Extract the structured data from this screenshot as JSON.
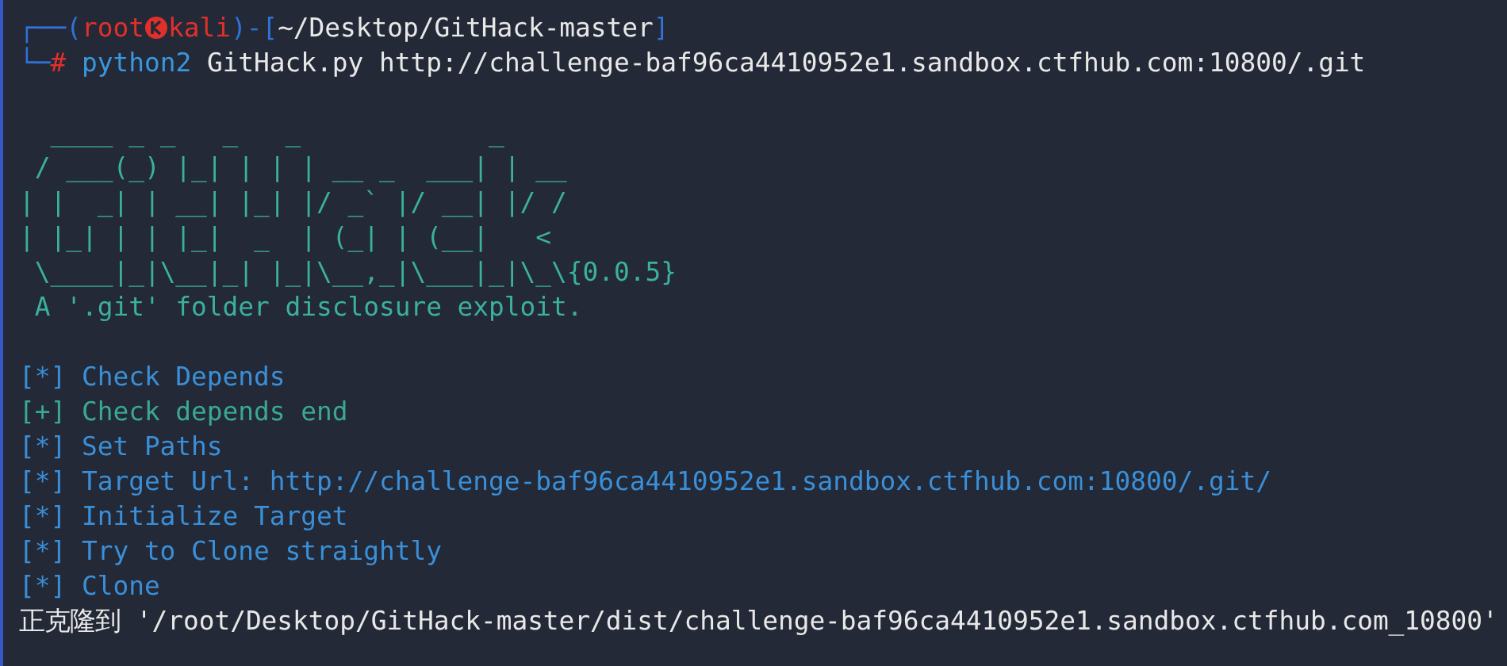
{
  "terminal": {
    "blocks": [
      {
        "lines": [
          {
            "segments": [
              {
                "kind": "frame",
                "text": "┌──("
              },
              {
                "kind": "user",
                "text": "root"
              },
              {
                "kind": "icon"
              },
              {
                "kind": "user",
                "text": "kali"
              },
              {
                "kind": "frame",
                "text": ")-["
              },
              {
                "kind": "path",
                "text": "~/Desktop/GitHack-master"
              },
              {
                "kind": "frame",
                "text": "]"
              }
            ]
          },
          {
            "segments": [
              {
                "kind": "frame",
                "text": "└─"
              },
              {
                "kind": "hash",
                "text": "#"
              },
              {
                "kind": "program",
                "text": " python2"
              },
              {
                "kind": "plain",
                "text": " GitHack.py http://challenge-baf96ca4410952e1.sandbox.ctfhub.com:10800/.git"
              }
            ]
          }
        ]
      },
      {
        "lines": [
          {
            "segments": [
              {
                "kind": "art",
                "text": "  ____ _ _   _   _            _"
              }
            ]
          },
          {
            "segments": [
              {
                "kind": "art",
                "text": " / ___(_) |_| | | | __ _  ___| | __"
              }
            ]
          },
          {
            "segments": [
              {
                "kind": "art",
                "text": "| |  _| | __| |_| |/ _` |/ __| |/ /"
              }
            ]
          },
          {
            "segments": [
              {
                "kind": "art",
                "text": "| |_| | | |_|  _  | (_| | (__|   <"
              }
            ]
          },
          {
            "segments": [
              {
                "kind": "art",
                "text": " \\____|_|\\__|_| |_|\\__,_|\\___|_|\\_\\{0.0.5}"
              }
            ]
          },
          {
            "segments": [
              {
                "kind": "art",
                "text": " A '.git' folder disclosure exploit."
              }
            ]
          }
        ]
      },
      {
        "lines": [
          {
            "segments": [
              {
                "kind": "info",
                "text": "[*] Check Depends"
              }
            ]
          },
          {
            "segments": [
              {
                "kind": "success",
                "text": "[+] Check depends end"
              }
            ]
          },
          {
            "segments": [
              {
                "kind": "info",
                "text": "[*] Set Paths"
              }
            ]
          },
          {
            "segments": [
              {
                "kind": "info",
                "text": "[*] Target Url: http://challenge-baf96ca4410952e1.sandbox.ctfhub.com:10800/.git/"
              }
            ]
          },
          {
            "segments": [
              {
                "kind": "info",
                "text": "[*] Initialize Target"
              }
            ]
          },
          {
            "segments": [
              {
                "kind": "info",
                "text": "[*] Try to Clone straightly"
              }
            ]
          },
          {
            "segments": [
              {
                "kind": "info",
                "text": "[*] Clone"
              }
            ]
          },
          {
            "segments": [
              {
                "kind": "plain",
                "text": "正克隆到 '/root/Desktop/GitHack-master/dist/challenge-baf96ca4410952e1.sandbox.ctfhub.com_10800'"
              }
            ]
          }
        ]
      }
    ]
  }
}
